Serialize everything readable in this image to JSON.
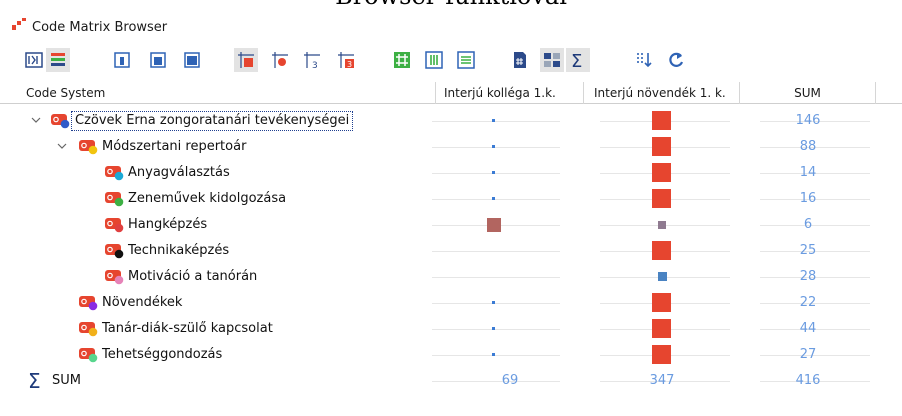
{
  "page_header": "Browser-funktiovai",
  "window": {
    "title": "Code Matrix Browser"
  },
  "toolbar_icons": [
    "binary-matrix-icon",
    "code-color-bars-icon",
    "window-layout-1-icon",
    "window-layout-2-icon",
    "window-layout-3-icon",
    "symbol-squares-icon",
    "symbol-dots-icon",
    "numeric-values-icon",
    "numeric-colored-icon",
    "hash-grid-icon",
    "columns-icon",
    "rows-icon",
    "document-hash-icon",
    "document-compare-icon",
    "sum-icon",
    "sort-columns-icon",
    "refresh-icon"
  ],
  "columns": {
    "system": "Code System",
    "c1": "Interjú kolléga 1.k.",
    "c2": "Interjú növendék 1. k.",
    "sum": "SUM"
  },
  "rows": [
    {
      "label": "Czövek Erna zongoratanári tevékenységei",
      "sum": "146",
      "c1": "dot",
      "c2": "big",
      "dot_color": "#2f5ac8",
      "level": 0
    },
    {
      "label": "Módszertani repertoár",
      "sum": "88",
      "c1": "dot",
      "c2": "big",
      "dot_color": "#f1c40f",
      "level": 1
    },
    {
      "label": "Anyagválasztás",
      "sum": "14",
      "c1": "dot",
      "c2": "big",
      "dot_color": "#1aa9d6",
      "level": 2
    },
    {
      "label": "Zeneművek kidolgozása",
      "sum": "16",
      "c1": "dot",
      "c2": "big",
      "dot_color": "#3cb043",
      "level": 2
    },
    {
      "label": "Hangképzés",
      "sum": "6",
      "c1": "rose",
      "c2": "gray",
      "dot_color": "#e04040",
      "level": 2
    },
    {
      "label": "Technikaképzés",
      "sum": "25",
      "c1": "none",
      "c2": "big",
      "dot_color": "#111111",
      "level": 2
    },
    {
      "label": "Motiváció a tanórán",
      "sum": "28",
      "c1": "none",
      "c2": "blue",
      "dot_color": "#e683b8",
      "level": 2
    },
    {
      "label": "Növendékek",
      "sum": "22",
      "c1": "dot",
      "c2": "big",
      "dot_color": "#8a2be2",
      "level": 1
    },
    {
      "label": "Tanár-diák-szülő kapcsolat",
      "sum": "44",
      "c1": "dot",
      "c2": "big",
      "dot_color": "#f1b01a",
      "level": 1
    },
    {
      "label": "Tehetséggondozás",
      "sum": "27",
      "c1": "dot",
      "c2": "big",
      "dot_color": "#58d68d",
      "level": 1
    }
  ],
  "totals": {
    "label": "SUM",
    "c1": "69",
    "c2": "347",
    "sum": "416"
  },
  "colors": {
    "code_icon": "#e6452f",
    "cell_square": "#e6452f",
    "link_blue": "#6a9be0",
    "sigma": "#1e3a7a"
  }
}
